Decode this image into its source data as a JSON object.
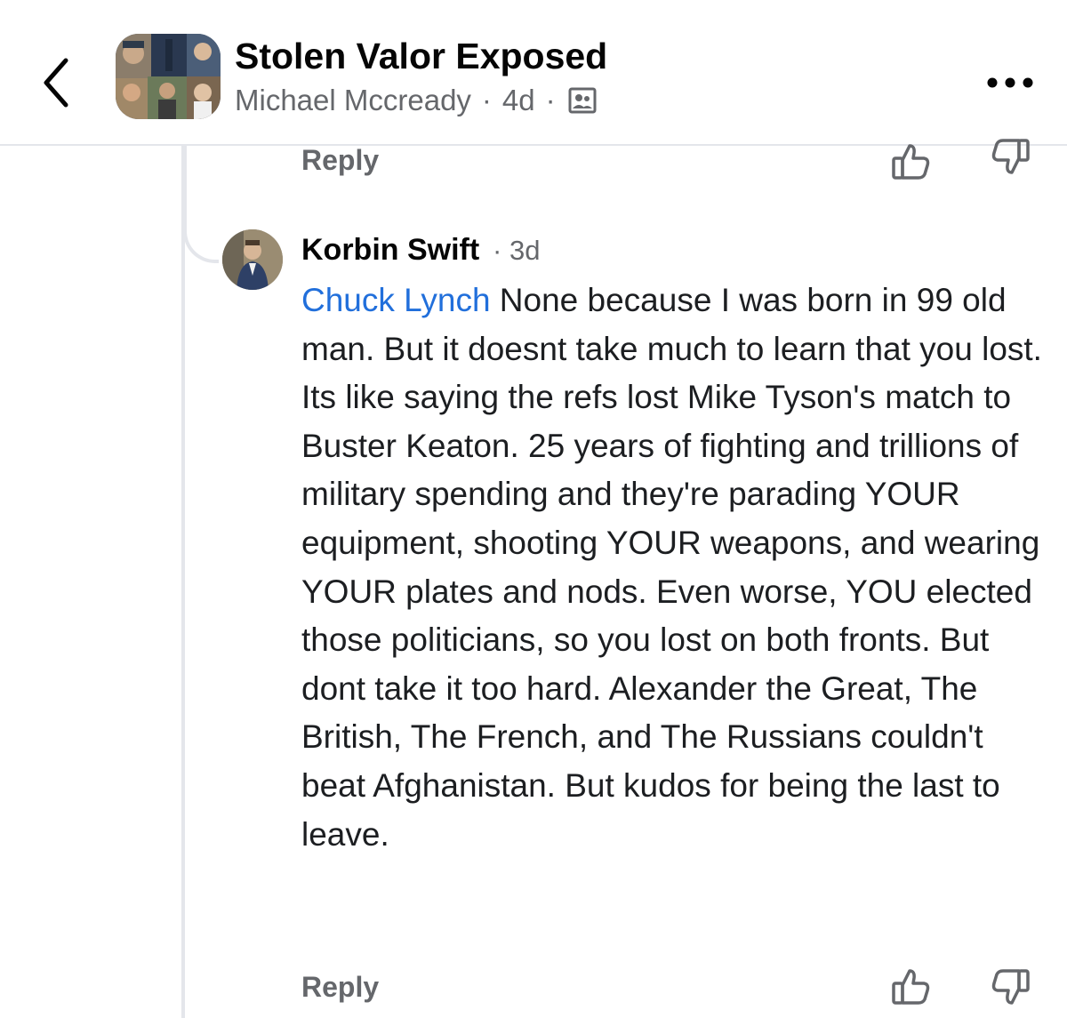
{
  "header": {
    "back_icon": "chevron-left-icon",
    "group_name": "Stolen Valor Exposed",
    "author": "Michael Mccready",
    "separator": "·",
    "time": "4d",
    "audience_icon": "members-audience-icon",
    "more_icon": "more-horizontal-icon"
  },
  "previous_comment": {
    "reply_label": "Reply",
    "like_icon": "thumbs-up-icon",
    "dislike_icon": "thumbs-down-icon"
  },
  "comment": {
    "author": "Korbin Swift",
    "separator": "·",
    "time": "3d",
    "mention": "Chuck Lynch",
    "text": " None because I was born in 99 old man. But it doesnt take much to learn that you lost. Its like saying the refs lost Mike Tyson's match to Buster Keaton. 25 years of fighting and trillions of military spending and they're parading YOUR equipment, shooting YOUR weapons, and wearing YOUR plates and nods. Even worse, YOU elected those politicians, so you lost on both fronts. But dont take it too hard. Alexander the Great, The British, The French, and The Russians couldn't beat Afghanistan. But kudos for being the last to leave.",
    "reply_label": "Reply",
    "like_icon": "thumbs-up-icon",
    "dislike_icon": "thumbs-down-icon"
  },
  "colors": {
    "mention": "#216fdb",
    "secondary_text": "#65676b",
    "primary_text": "#1c1e21",
    "divider": "#e4e6eb"
  }
}
